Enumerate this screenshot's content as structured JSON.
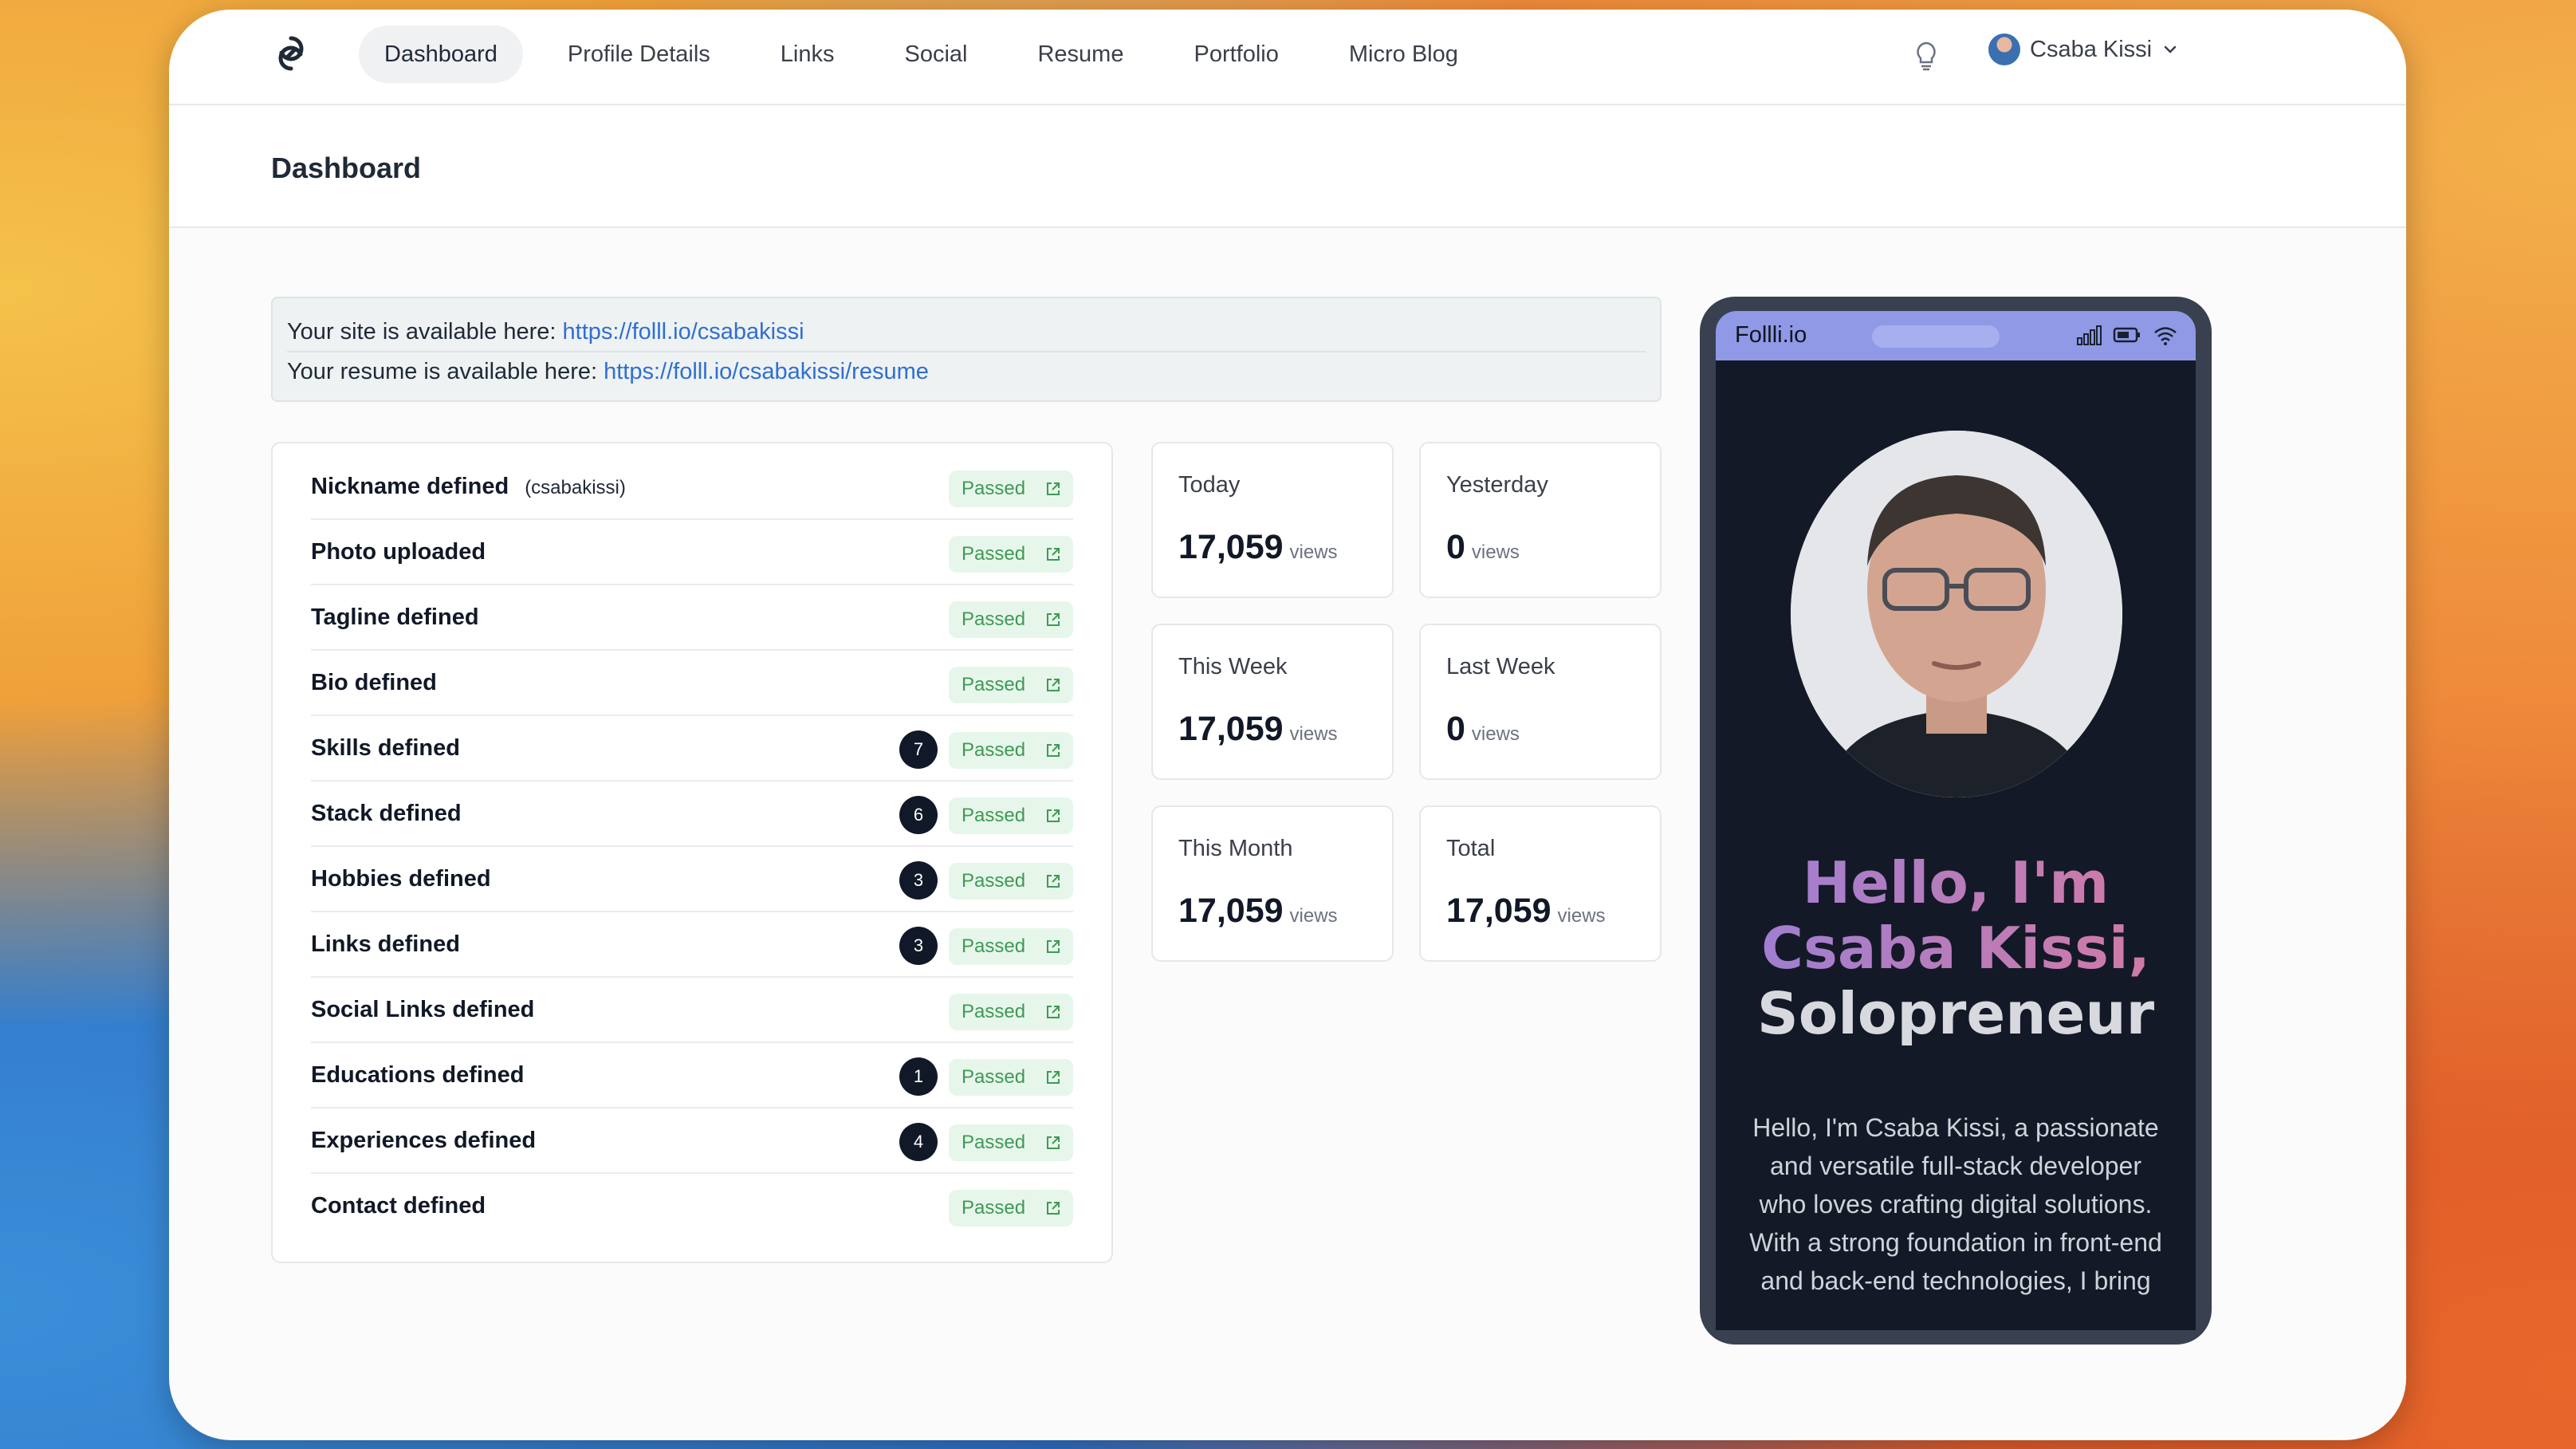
{
  "nav": {
    "tabs": [
      {
        "label": "Dashboard",
        "active": true
      },
      {
        "label": "Profile Details"
      },
      {
        "label": "Links"
      },
      {
        "label": "Social"
      },
      {
        "label": "Resume"
      },
      {
        "label": "Portfolio"
      },
      {
        "label": "Micro Blog"
      }
    ],
    "user_name": "Csaba Kissi"
  },
  "page": {
    "title": "Dashboard"
  },
  "info": {
    "site_prefix": "Your site is available here:",
    "site_url": "https://folll.io/csabakissi",
    "resume_prefix": "Your resume is available here:",
    "resume_url": "https://folll.io/csabakissi/resume"
  },
  "checklist": [
    {
      "label": "Nickname defined",
      "sub": "(csabakissi)",
      "count": null,
      "status": "Passed"
    },
    {
      "label": "Photo uploaded",
      "sub": "",
      "count": null,
      "status": "Passed"
    },
    {
      "label": "Tagline defined",
      "sub": "",
      "count": null,
      "status": "Passed"
    },
    {
      "label": "Bio defined",
      "sub": "",
      "count": null,
      "status": "Passed"
    },
    {
      "label": "Skills defined",
      "sub": "",
      "count": "7",
      "status": "Passed"
    },
    {
      "label": "Stack defined",
      "sub": "",
      "count": "6",
      "status": "Passed"
    },
    {
      "label": "Hobbies defined",
      "sub": "",
      "count": "3",
      "status": "Passed"
    },
    {
      "label": "Links defined",
      "sub": "",
      "count": "3",
      "status": "Passed"
    },
    {
      "label": "Social Links defined",
      "sub": "",
      "count": null,
      "status": "Passed"
    },
    {
      "label": "Educations defined",
      "sub": "",
      "count": "1",
      "status": "Passed"
    },
    {
      "label": "Experiences defined",
      "sub": "",
      "count": "4",
      "status": "Passed"
    },
    {
      "label": "Contact defined",
      "sub": "",
      "count": null,
      "status": "Passed"
    }
  ],
  "stats": {
    "today": {
      "label": "Today",
      "value": "17,059",
      "unit": "views"
    },
    "yesterday": {
      "label": "Yesterday",
      "value": "0",
      "unit": "views"
    },
    "this_week": {
      "label": "This Week",
      "value": "17,059",
      "unit": "views"
    },
    "last_week": {
      "label": "Last Week",
      "value": "0",
      "unit": "views"
    },
    "this_month": {
      "label": "This Month",
      "value": "17,059",
      "unit": "views"
    },
    "total": {
      "label": "Total",
      "value": "17,059",
      "unit": "views"
    }
  },
  "phone": {
    "brand": "Follli.io",
    "hero_line1": "Hello, I'm",
    "hero_line2": "Csaba Kissi,",
    "hero_line3": "Solopreneur",
    "bio": "Hello, I'm Csaba Kissi, a passionate and versatile full-stack developer who loves crafting digital solutions. With a strong foundation in front-end and back-end technologies, I bring"
  },
  "colors": {
    "accent_link": "#2f6fd1",
    "passed_bg": "#e7f6ea",
    "passed_text": "#3e9a55",
    "phone_bar": "#8f99e6"
  }
}
